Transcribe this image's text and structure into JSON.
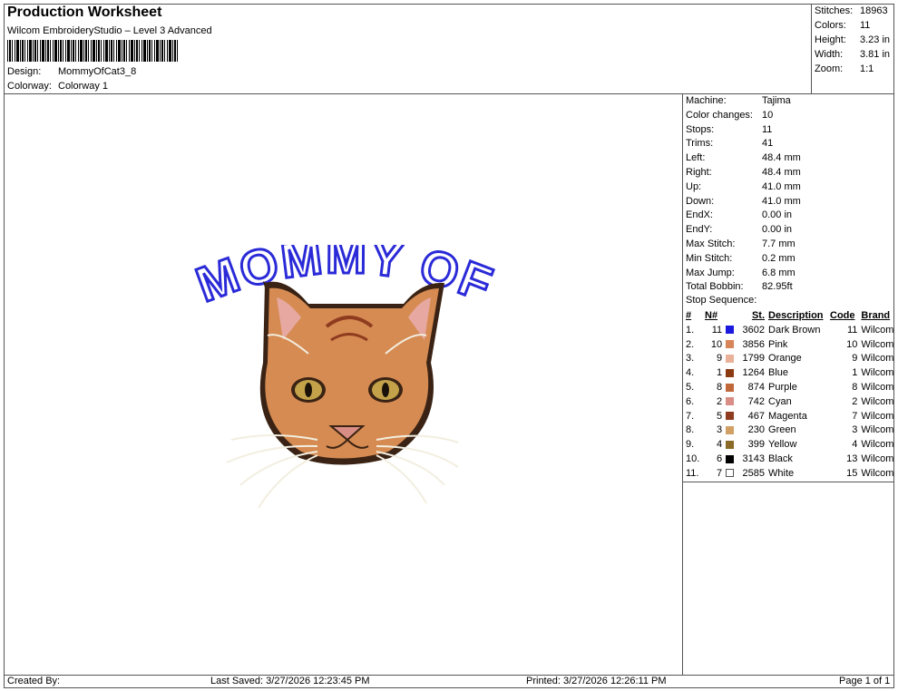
{
  "header": {
    "title": "Production Worksheet",
    "subtitle": "Wilcom EmbroideryStudio – Level 3 Advanced",
    "design_label": "Design:",
    "design_value": "MommyOfCat3_8",
    "colorway_label": "Colorway:",
    "colorway_value": "Colorway 1"
  },
  "summary": [
    {
      "label": "Stitches:",
      "value": "18963"
    },
    {
      "label": "Colors:",
      "value": "11"
    },
    {
      "label": "Height:",
      "value": "3.23 in"
    },
    {
      "label": "Width:",
      "value": "3.81 in"
    },
    {
      "label": "Zoom:",
      "value": "1:1"
    }
  ],
  "machine_info": [
    {
      "label": "Machine:",
      "value": "Tajima"
    },
    {
      "label": "Color changes:",
      "value": "10"
    },
    {
      "label": "Stops:",
      "value": "11"
    },
    {
      "label": "Trims:",
      "value": "41"
    },
    {
      "label": "Left:",
      "value": "48.4 mm"
    },
    {
      "label": "Right:",
      "value": "48.4 mm"
    },
    {
      "label": "Up:",
      "value": "41.0 mm"
    },
    {
      "label": "Down:",
      "value": "41.0 mm"
    },
    {
      "label": "EndX:",
      "value": "0.00 in"
    },
    {
      "label": "EndY:",
      "value": "0.00 in"
    },
    {
      "label": "Max Stitch:",
      "value": "7.7 mm"
    },
    {
      "label": "Min Stitch:",
      "value": "0.2 mm"
    },
    {
      "label": "Max Jump:",
      "value": "6.8 mm"
    },
    {
      "label": "Total Bobbin:",
      "value": "82.95ft"
    }
  ],
  "stop_sequence": {
    "title": "Stop Sequence:",
    "headers": {
      "idx": "#",
      "n": "N#",
      "st": "St.",
      "desc": "Description",
      "code": "Code",
      "brand": "Brand"
    },
    "rows": [
      {
        "idx": "1.",
        "n": "11",
        "color": "#1a1adf",
        "st": "3602",
        "desc": "Dark Brown",
        "code": "11",
        "brand": "Wilcom"
      },
      {
        "idx": "2.",
        "n": "10",
        "color": "#d9855a",
        "st": "3856",
        "desc": "Pink",
        "code": "10",
        "brand": "Wilcom"
      },
      {
        "idx": "3.",
        "n": "9",
        "color": "#e9b298",
        "st": "1799",
        "desc": "Orange",
        "code": "9",
        "brand": "Wilcom"
      },
      {
        "idx": "4.",
        "n": "1",
        "color": "#8b3a12",
        "st": "1264",
        "desc": "Blue",
        "code": "1",
        "brand": "Wilcom"
      },
      {
        "idx": "5.",
        "n": "8",
        "color": "#c0683a",
        "st": "874",
        "desc": "Purple",
        "code": "8",
        "brand": "Wilcom"
      },
      {
        "idx": "6.",
        "n": "2",
        "color": "#d98e85",
        "st": "742",
        "desc": "Cyan",
        "code": "2",
        "brand": "Wilcom"
      },
      {
        "idx": "7.",
        "n": "5",
        "color": "#8e3b1f",
        "st": "467",
        "desc": "Magenta",
        "code": "7",
        "brand": "Wilcom"
      },
      {
        "idx": "8.",
        "n": "3",
        "color": "#d2a064",
        "st": "230",
        "desc": "Green",
        "code": "3",
        "brand": "Wilcom"
      },
      {
        "idx": "9.",
        "n": "4",
        "color": "#8a6a26",
        "st": "399",
        "desc": "Yellow",
        "code": "4",
        "brand": "Wilcom"
      },
      {
        "idx": "10.",
        "n": "6",
        "color": "#000000",
        "st": "3143",
        "desc": "Black",
        "code": "13",
        "brand": "Wilcom"
      },
      {
        "idx": "11.",
        "n": "7",
        "color": "#ffffff",
        "st": "2585",
        "desc": "White",
        "code": "15",
        "brand": "Wilcom"
      }
    ]
  },
  "design_preview": {
    "arc_text": "MOMMY OF"
  },
  "footer": {
    "created": "Created By:",
    "saved": "Last Saved: 3/27/2026 12:23:45 PM",
    "printed": "Printed: 3/27/2026 12:26:11 PM",
    "page": "Page 1 of 1"
  }
}
